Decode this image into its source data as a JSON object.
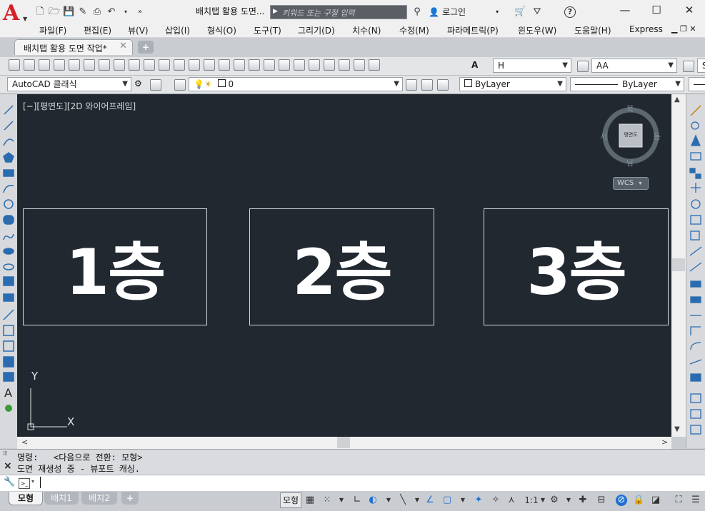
{
  "title_bar": {
    "doc_title": "배치탭 활용 도면...",
    "search_placeholder": "키워드 또는 구절 입력",
    "login_label": "로그인",
    "minimize": "—",
    "maximize": "☐",
    "close": "✕"
  },
  "menu": {
    "items": [
      "파일(F)",
      "편집(E)",
      "뷰(V)",
      "삽입(I)",
      "형식(O)",
      "도구(T)",
      "그리기(D)",
      "치수(N)",
      "수정(M)",
      "파라메트릭(P)",
      "윈도우(W)",
      "도움말(H)",
      "Express"
    ]
  },
  "tabs": {
    "doc_tab": "배치탭 활용 도면 작업*",
    "close_glyph": "✕",
    "new_tab_glyph": "+"
  },
  "toolbar1": {
    "text_style": "H",
    "dim_style": "AA",
    "table_style": "S"
  },
  "toolbar2": {
    "workspace": "AutoCAD 클래식",
    "layer": "0",
    "color": "ByLayer",
    "linetype": "ByLayer"
  },
  "canvas": {
    "viewport_label": "[−][평면도][2D 와이어프레임]",
    "floors": [
      "1층",
      "2층",
      "3층"
    ],
    "viewcube": {
      "north": "북",
      "south": "남",
      "east": "동",
      "west": "서",
      "face": "평면도",
      "wcs_label": "WCS"
    },
    "ucs": {
      "x_label": "X",
      "y_label": "Y"
    }
  },
  "command": {
    "history": [
      "명령:   <다음으로 전환: 모형>",
      "도면 재생성 중 - 뷰포트 캐싱."
    ],
    "input_value": ""
  },
  "status": {
    "layout_tabs": [
      "모형",
      "배치1",
      "배치2"
    ],
    "model_button": "모형",
    "scale": "1:1"
  },
  "colors": {
    "canvas_bg": "#212830",
    "logo_red": "#d51f26",
    "accent_blue": "#1f6fd1"
  }
}
